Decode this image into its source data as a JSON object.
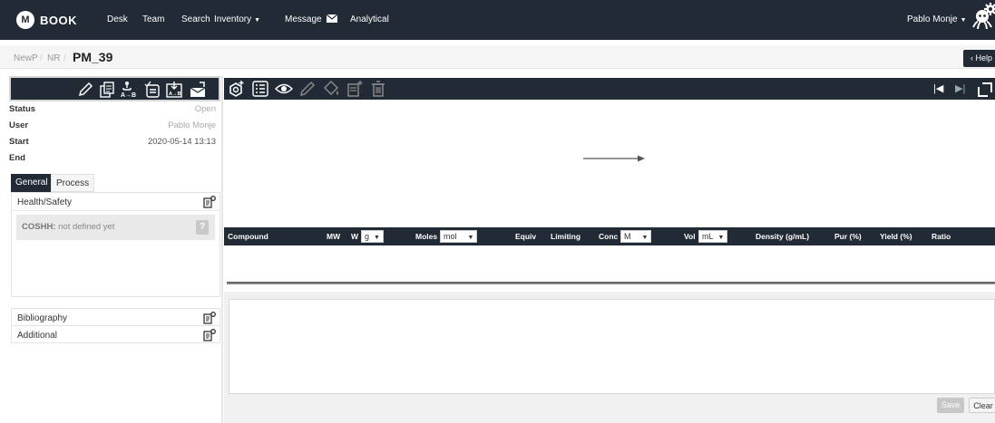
{
  "navbar": {
    "brand_logo": "M",
    "brand": "BOOK",
    "links": [
      "Desk",
      "Team",
      "Search",
      "Inventory",
      "Message",
      "Analytical"
    ],
    "user": "Pablo Monje",
    "bg_color": "#222a35"
  },
  "breadcrumb": {
    "items": [
      "NewP",
      "NR"
    ],
    "title": "PM_39",
    "help_label": "Help"
  },
  "info": {
    "status_label": "Status",
    "status_value": "Open",
    "user_label": "User",
    "user_value": "Pablo Monje",
    "start_label": "Start",
    "start_value": "2020-05-14 13:13",
    "end_label": "End",
    "end_value": ""
  },
  "tabs": {
    "general": "General",
    "process": "Process"
  },
  "sections": {
    "health_safety": "Health/Safety",
    "coshh_label": "COSHH:",
    "coshh_value": "not defined yet",
    "coshh_icon": "?",
    "bibliography": "Bibliography",
    "additional": "Additional"
  },
  "table": {
    "headers": {
      "compound": "Compound",
      "mw": "MW",
      "w": "W",
      "moles": "Moles",
      "equiv": "Equiv",
      "limiting": "Limiting",
      "conc": "Conc",
      "vol": "Vol",
      "density": "Density (g/mL)",
      "pur": "Pur (%)",
      "yield": "Yield (%)",
      "ratio": "Ratio"
    },
    "units": {
      "w": "g",
      "moles": "mol",
      "conc": "M",
      "vol": "mL"
    }
  },
  "editor": {
    "save_label": "Save",
    "clear_label": "Clear"
  },
  "icons": {
    "left_toolbar": [
      "pencil-icon",
      "copy-icon",
      "reaction-a-b-icon",
      "checklist-icon",
      "import-a-b-icon",
      "inbox-icon"
    ],
    "right_toolbar": [
      "add-settings-icon",
      "list-icon",
      "eye-icon",
      "pencil-icon",
      "paint-bucket-icon",
      "add-file-icon",
      "trash-icon"
    ],
    "nav": [
      "first-icon",
      "last-icon",
      "expand-icon",
      "gear-icon",
      "octopus-icon"
    ]
  }
}
